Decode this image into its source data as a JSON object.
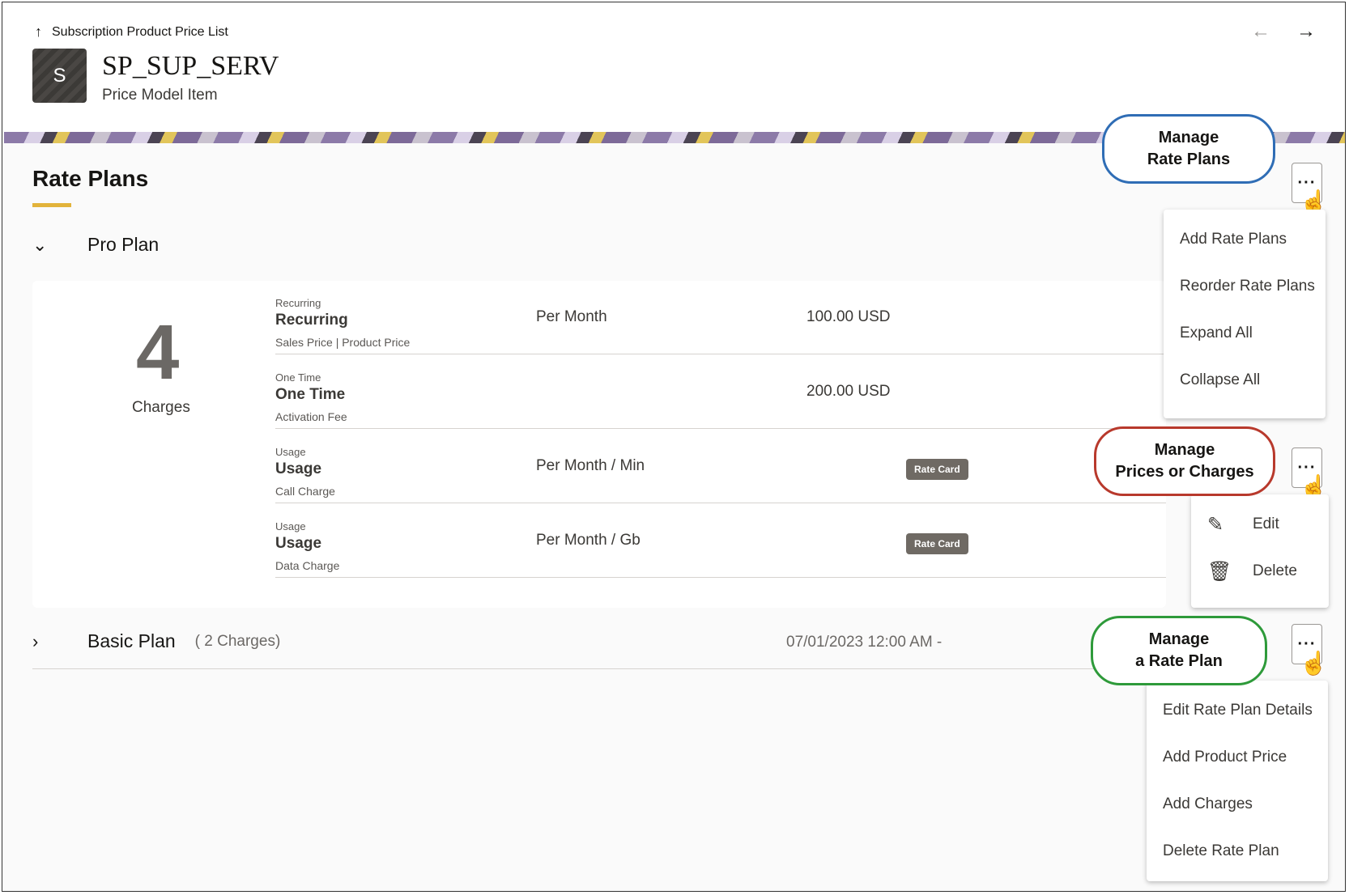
{
  "header": {
    "breadcrumb": "Subscription Product Price List",
    "avatar_letter": "S",
    "title": "SP_SUP_SERV",
    "subtitle": "Price Model Item",
    "prev_icon": "←",
    "next_icon": "→"
  },
  "section": {
    "title": "Rate Plans"
  },
  "pro_plan": {
    "name": "Pro Plan",
    "charge_count": "4",
    "charge_count_label": "Charges",
    "charges": [
      {
        "type_small": "Recurring",
        "type": "Recurring",
        "desc": "Sales Price | Product Price",
        "frequency": "Per Month",
        "price": "100.00 USD",
        "badge": ""
      },
      {
        "type_small": "One Time",
        "type": "One Time",
        "desc": "Activation Fee",
        "frequency": "",
        "price": "200.00 USD",
        "badge": ""
      },
      {
        "type_small": "Usage",
        "type": "Usage",
        "desc": "Call Charge",
        "frequency": "Per Month / Min",
        "price": "",
        "badge": "Rate Card"
      },
      {
        "type_small": "Usage",
        "type": "Usage",
        "desc": "Data Charge",
        "frequency": "Per Month / Gb",
        "price": "",
        "badge": "Rate Card"
      }
    ]
  },
  "basic_plan": {
    "name": "Basic Plan",
    "count": "( 2 Charges)",
    "date": "07/01/2023 12:00 AM -"
  },
  "menus": {
    "rate_plans": [
      "Add Rate Plans",
      "Reorder Rate Plans",
      "Expand All",
      "Collapse All"
    ],
    "charges": [
      "Edit",
      "Delete"
    ],
    "rate_plan": [
      "Edit Rate Plan Details",
      "Add Product Price",
      "Add Charges",
      "Delete Rate Plan"
    ]
  },
  "callouts": {
    "rate_plans": [
      "Manage",
      "Rate Plans"
    ],
    "charges": [
      "Manage",
      "Prices or Charges"
    ],
    "rate_plan": [
      "Manage",
      "a Rate Plan"
    ]
  },
  "colors": {
    "blue": "#2f6db5",
    "red": "#b8392c",
    "green": "#2e9a3a",
    "accent": "#e2b33b"
  },
  "icons": {
    "kebab": "···",
    "cursor": "☝",
    "edit": "✎",
    "delete": "🗑"
  }
}
